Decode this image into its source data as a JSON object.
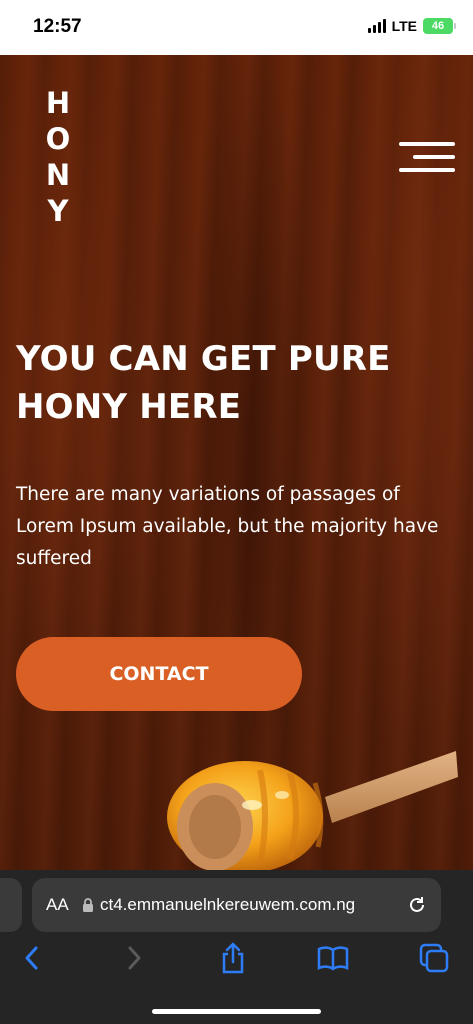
{
  "status_bar": {
    "time": "12:57",
    "network": "LTE",
    "battery": "46"
  },
  "hero": {
    "logo_letters": [
      "H",
      "O",
      "N",
      "Y"
    ],
    "headline_line1": "YOU CAN GET PURE",
    "headline_line2": "HONY HERE",
    "description": "There are many variations of passages of Lorem Ipsum available, but the majority have suffered",
    "contact_label": "CONTACT"
  },
  "browser": {
    "text_size_label": "AA",
    "url": "ct4.emmanuelnkereuwem.com.ng"
  },
  "colors": {
    "background": "#59200a",
    "accent": "#d95f24",
    "battery": "#4cd964",
    "browser_tint": "#2e7cf6"
  },
  "icons": [
    "menu-icon",
    "lock-icon",
    "reload-icon",
    "back-icon",
    "forward-icon",
    "share-icon",
    "bookmarks-icon",
    "tabs-icon"
  ]
}
